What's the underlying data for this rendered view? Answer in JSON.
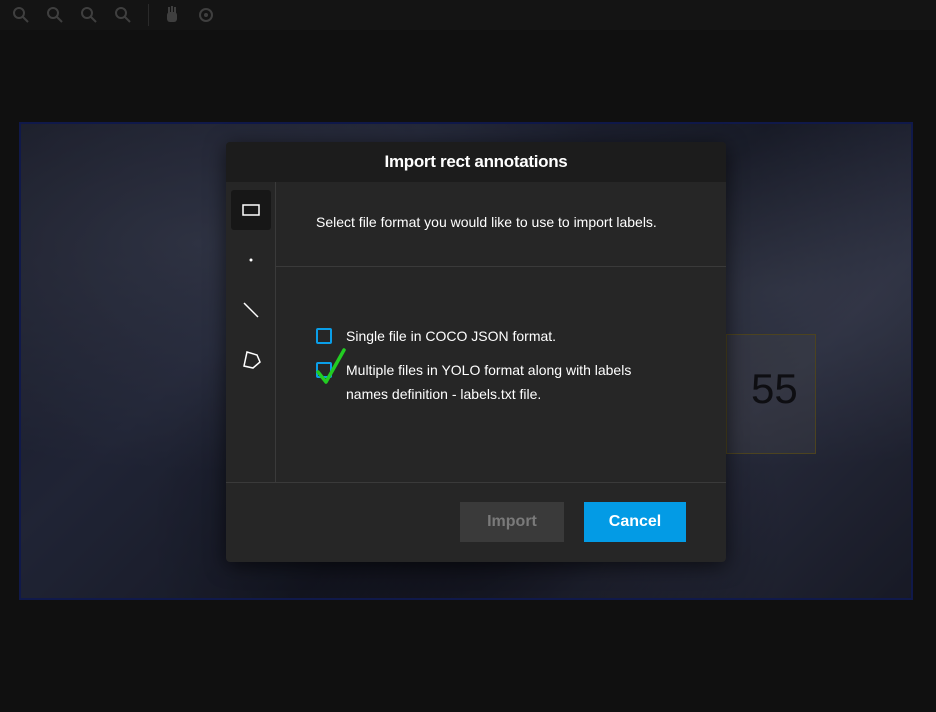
{
  "toolbar": {
    "buttons": [
      "zoom-in-icon",
      "zoom-out-icon",
      "zoom-fit-icon",
      "zoom-max-icon",
      "hand-icon",
      "crosshair-icon"
    ]
  },
  "image": {
    "plate_text": "55"
  },
  "modal": {
    "title": "Import rect annotations",
    "description": "Select file format you would like to use to import labels.",
    "options": [
      {
        "label": "Single file in COCO JSON format.",
        "checked": false
      },
      {
        "label": "Multiple files in YOLO format along with labels names definition - labels.txt file.",
        "checked": true
      }
    ],
    "side_tools": [
      "rect-icon",
      "point-icon",
      "line-icon",
      "polygon-icon"
    ],
    "import_label": "Import",
    "cancel_label": "Cancel"
  },
  "colors": {
    "accent": "#039be5",
    "check": "#22cc22",
    "modal_bg": "#262626",
    "header_bg": "#1c1c1c"
  }
}
